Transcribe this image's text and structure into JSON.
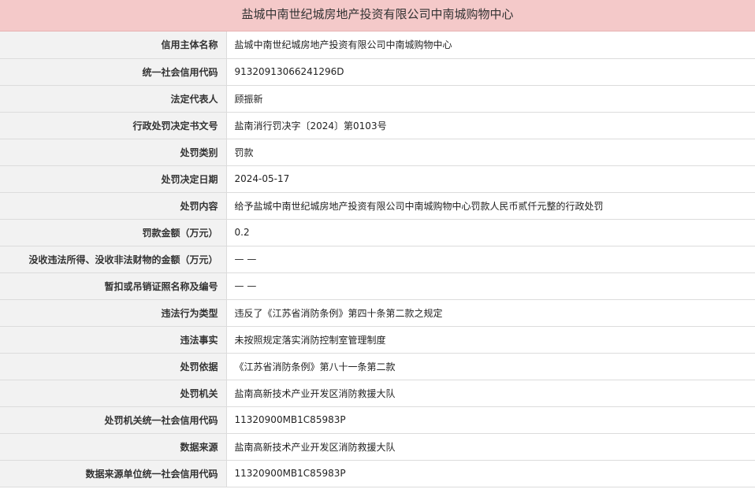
{
  "title": "盐城中南世纪城房地产投资有限公司中南城购物中心",
  "rows": [
    {
      "label": "信用主体名称",
      "value": "盐城中南世纪城房地产投资有限公司中南城购物中心"
    },
    {
      "label": "统一社会信用代码",
      "value": "91320913066241296D"
    },
    {
      "label": "法定代表人",
      "value": "顾振新"
    },
    {
      "label": "行政处罚决定书文号",
      "value": "盐南消行罚决字〔2024〕第0103号"
    },
    {
      "label": "处罚类别",
      "value": "罚款"
    },
    {
      "label": "处罚决定日期",
      "value": "2024-05-17"
    },
    {
      "label": "处罚内容",
      "value": "给予盐城中南世纪城房地产投资有限公司中南城购物中心罚款人民币贰仟元整的行政处罚"
    },
    {
      "label": "罚款金额（万元）",
      "value": "0.2"
    },
    {
      "label": "没收违法所得、没收非法财物的金额（万元）",
      "value": "— —"
    },
    {
      "label": "暂扣或吊销证照名称及编号",
      "value": "— —"
    },
    {
      "label": "违法行为类型",
      "value": "违反了《江苏省消防条例》第四十条第二款之规定"
    },
    {
      "label": "违法事实",
      "value": "未按照规定落实消防控制室管理制度"
    },
    {
      "label": "处罚依据",
      "value": "《江苏省消防条例》第八十一条第二款"
    },
    {
      "label": "处罚机关",
      "value": "盐南高新技术产业开发区消防救援大队"
    },
    {
      "label": "处罚机关统一社会信用代码",
      "value": "11320900MB1C85983P"
    },
    {
      "label": "数据来源",
      "value": "盐南高新技术产业开发区消防救援大队"
    },
    {
      "label": "数据来源单位统一社会信用代码",
      "value": "11320900MB1C85983P"
    }
  ]
}
